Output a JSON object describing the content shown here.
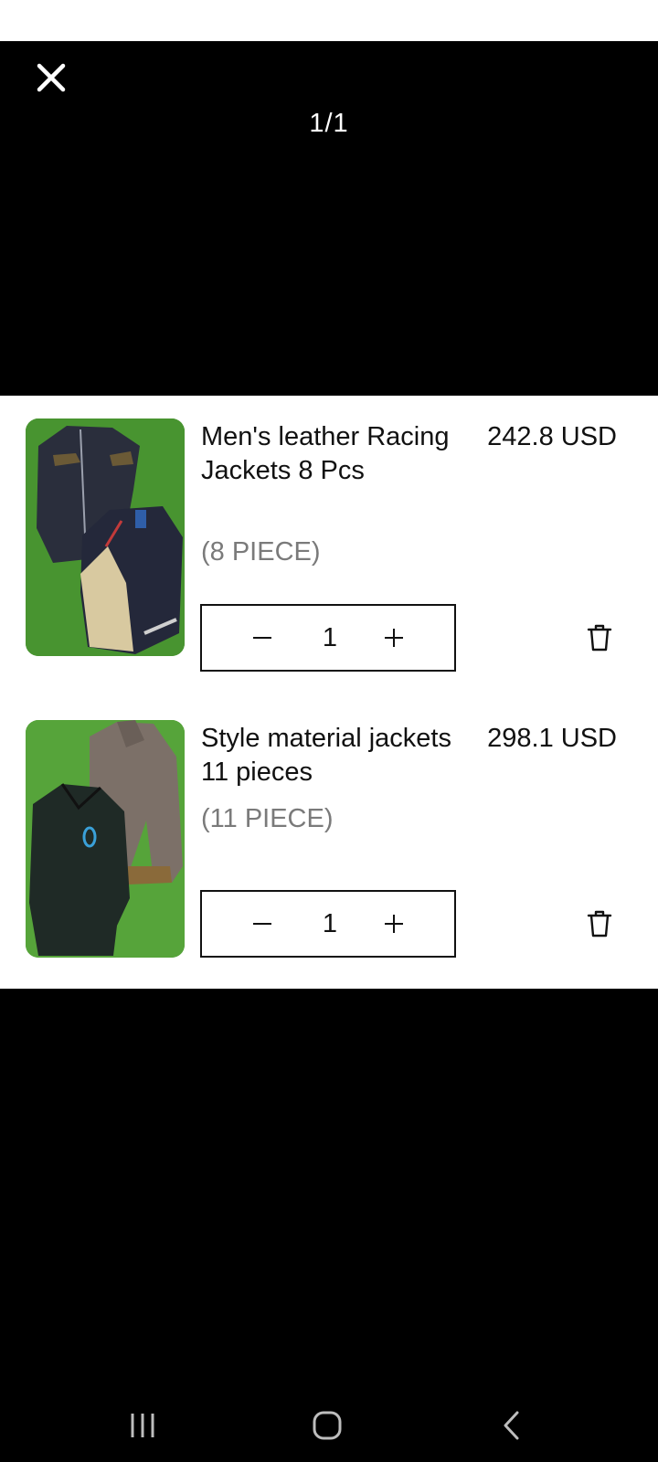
{
  "viewer": {
    "counter": "1/1",
    "close_icon": "close-icon"
  },
  "cart": {
    "items": [
      {
        "title": "Men's leather Racing Jackets 8 Pcs",
        "price": "242.8 USD",
        "unit": "(8  PIECE)",
        "quantity": "1",
        "image": "leather-jackets-photo"
      },
      {
        "title": "Style material jackets 11 pieces",
        "price": "298.1 USD",
        "unit": "(11  PIECE)",
        "quantity": "1",
        "image": "material-jackets-photo"
      }
    ]
  },
  "icons": {
    "minus": "minus-icon",
    "plus": "plus-icon",
    "delete": "trash-icon"
  },
  "nav": {
    "recents": "recents-icon",
    "home": "home-icon",
    "back": "back-icon"
  },
  "colors": {
    "background": "#000000",
    "sheet": "#ffffff",
    "text": "#111111",
    "muted": "#7a7a7a",
    "grass": "#4f9a34"
  }
}
